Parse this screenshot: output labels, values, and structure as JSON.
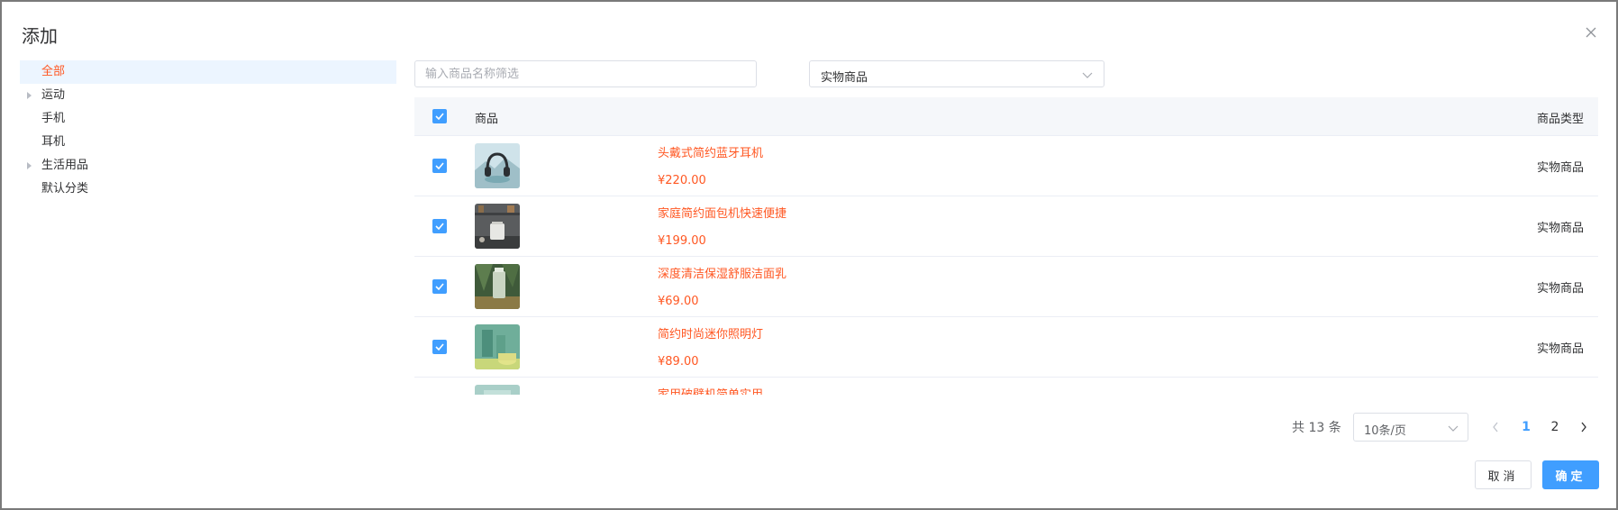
{
  "dialog": {
    "title": "添加"
  },
  "tree": {
    "items": [
      {
        "label": "全部",
        "active": true,
        "has_children": false
      },
      {
        "label": "运动",
        "active": false,
        "has_children": true
      },
      {
        "label": "手机",
        "active": false,
        "has_children": false
      },
      {
        "label": "耳机",
        "active": false,
        "has_children": false
      },
      {
        "label": "生活用品",
        "active": false,
        "has_children": true
      },
      {
        "label": "默认分类",
        "active": false,
        "has_children": false
      }
    ]
  },
  "filters": {
    "search_placeholder": "输入商品名称筛选",
    "search_value": "",
    "type_select_value": "实物商品"
  },
  "table": {
    "headers": {
      "goods": "商品",
      "type": "商品类型"
    },
    "all_checked": true,
    "rows": [
      {
        "name": "头戴式简约蓝牙耳机",
        "price": "¥220.00",
        "type": "实物商品",
        "checked": true
      },
      {
        "name": "家庭简约面包机快速便捷",
        "price": "¥199.00",
        "type": "实物商品",
        "checked": true
      },
      {
        "name": "深度清洁保湿舒服洁面乳",
        "price": "¥69.00",
        "type": "实物商品",
        "checked": true
      },
      {
        "name": "简约时尚迷你照明灯",
        "price": "¥89.00",
        "type": "实物商品",
        "checked": true
      },
      {
        "name": "家用破壁机简单实用",
        "price": "",
        "type": "",
        "checked": true
      }
    ]
  },
  "pagination": {
    "total_text": "共 13 条",
    "page_size": "10条/页",
    "pages": [
      "1",
      "2"
    ],
    "current_page": "1"
  },
  "footer": {
    "cancel_label": "取消",
    "ok_label": "确定"
  },
  "colors": {
    "accent": "#409eff",
    "brand_text": "#ff5722"
  }
}
